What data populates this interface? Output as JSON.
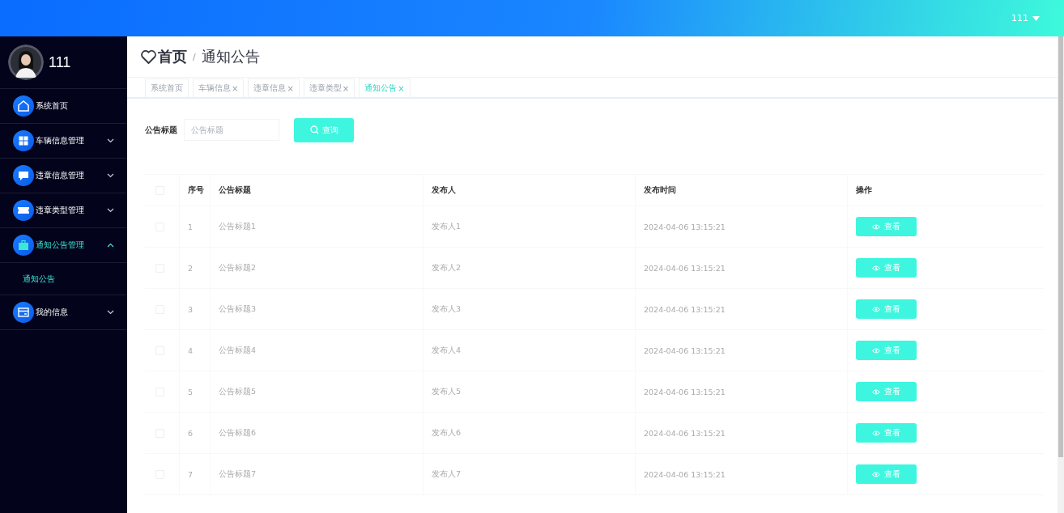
{
  "top_bar": {
    "user": "111"
  },
  "sidebar": {
    "username": "111",
    "items": [
      {
        "label": "系统首页",
        "active": false
      },
      {
        "label": "车辆信息管理",
        "expanded": false,
        "active": false
      },
      {
        "label": "违章信息管理",
        "expanded": false,
        "active": false
      },
      {
        "label": "违章类型管理",
        "expanded": false,
        "active": false
      },
      {
        "label": "通知公告管理",
        "expanded": true,
        "active": true,
        "children": [
          {
            "label": "通知公告",
            "selected": true
          }
        ]
      },
      {
        "label": "我的信息",
        "expanded": false,
        "active": false
      }
    ]
  },
  "breadcrumb": {
    "home": "首页",
    "separator": "/",
    "current": "通知公告"
  },
  "tabs": [
    {
      "label": "系统首页",
      "selected": false
    },
    {
      "label": "车辆信息",
      "close": "×",
      "selected": false
    },
    {
      "label": "违章信息",
      "close": "×",
      "selected": false
    },
    {
      "label": "违章类型",
      "close": "×",
      "selected": false
    },
    {
      "label": "通知公告",
      "close": "×",
      "selected": true
    }
  ],
  "search": {
    "label": "公告标题",
    "placeholder": "公告标题",
    "button": "查询"
  },
  "table": {
    "all_checked": false,
    "columns": [
      "序号",
      "公告标题",
      "发布人",
      "发布时间",
      "操作"
    ],
    "rows": [
      {
        "index": "1",
        "title": "公告标题1",
        "publisher": "发布人1",
        "time": "2024-04-06 13:15:21",
        "action": "查看",
        "checked": false
      },
      {
        "index": "2",
        "title": "公告标题2",
        "publisher": "发布人2",
        "time": "2024-04-06 13:15:21",
        "action": "查看",
        "checked": false
      },
      {
        "index": "3",
        "title": "公告标题3",
        "publisher": "发布人3",
        "time": "2024-04-06 13:15:21",
        "action": "查看",
        "checked": false
      },
      {
        "index": "4",
        "title": "公告标题4",
        "publisher": "发布人4",
        "time": "2024-04-06 13:15:21",
        "action": "查看",
        "checked": false
      },
      {
        "index": "5",
        "title": "公告标题5",
        "publisher": "发布人5",
        "time": "2024-04-06 13:15:21",
        "action": "查看",
        "checked": false
      },
      {
        "index": "6",
        "title": "公告标题6",
        "publisher": "发布人6",
        "time": "2024-04-06 13:15:21",
        "action": "查看",
        "checked": false
      },
      {
        "index": "7",
        "title": "公告标题7",
        "publisher": "发布人7",
        "time": "2024-04-06 13:15:21",
        "action": "查看",
        "checked": false
      }
    ]
  }
}
